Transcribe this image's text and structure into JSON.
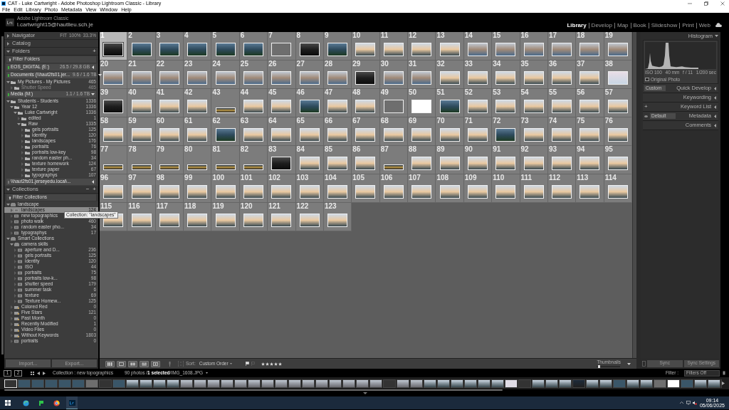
{
  "window": {
    "title": "CAT - Luke Cartwright - Adobe Photoshop Lightroom Classic - Library"
  },
  "menu": [
    "File",
    "Edit",
    "Library",
    "Photo",
    "Metadata",
    "View",
    "Window",
    "Help"
  ],
  "identity": {
    "product": "Adobe Lightroom Classic",
    "user": "l.cartwright15@hautlieu.sch.je"
  },
  "modules": [
    {
      "label": "Library",
      "selected": true
    },
    {
      "label": "Develop",
      "selected": false
    },
    {
      "label": "Map",
      "selected": false
    },
    {
      "label": "Book",
      "selected": false
    },
    {
      "label": "Slideshow",
      "selected": false
    },
    {
      "label": "Print",
      "selected": false
    },
    {
      "label": "Web",
      "selected": false
    }
  ],
  "navigator": {
    "title": "Navigator",
    "zoom_options": [
      "FIT",
      "100%",
      "33.3%"
    ]
  },
  "catalog": {
    "title": "Catalog"
  },
  "folders": {
    "title": "Folders",
    "add_button": "+",
    "filter": "Filter Folders",
    "volumes": [
      {
        "name": "EOS_DIGITAL (E:)",
        "space": "26.5 / 29.8 GB",
        "online": true,
        "expanded": false
      },
      {
        "name": "Documents (\\\\haut2fs01.jer...",
        "space": "9.6 / 1.6 TB",
        "online": true,
        "expanded": true,
        "children": [
          {
            "label": "My Pictures - My Pictures",
            "count": "465",
            "expanded": true,
            "selected": false,
            "children": [
              {
                "label": "Shutter Speed",
                "count": "465",
                "expanded": false,
                "selected": false,
                "disabled": true
              }
            ]
          }
        ]
      },
      {
        "name": "Media (M:)",
        "space": "1.1 / 1.6 TB",
        "online": true,
        "expanded": true,
        "children": [
          {
            "label": "Students - Students",
            "count": "1336",
            "expanded": true,
            "selected": false,
            "children": [
              {
                "label": "Year 12",
                "count": "1336",
                "expanded": true,
                "selected": false,
                "children": [
                  {
                    "label": "Luke Cartwright",
                    "count": "1336",
                    "expanded": true,
                    "selected": false,
                    "children": [
                      {
                        "label": "edited",
                        "count": "1",
                        "expanded": false,
                        "selected": false
                      },
                      {
                        "label": "Raw",
                        "count": "1335",
                        "expanded": true,
                        "selected": false,
                        "children": [
                          {
                            "label": "gels portraits",
                            "count": "125",
                            "expanded": false,
                            "selected": false
                          },
                          {
                            "label": "identity",
                            "count": "120",
                            "expanded": false,
                            "selected": false
                          },
                          {
                            "label": "landscapes",
                            "count": "176",
                            "expanded": false,
                            "selected": false
                          },
                          {
                            "label": "portraits",
                            "count": "76",
                            "expanded": false,
                            "selected": false
                          },
                          {
                            "label": "portraits low-key",
                            "count": "98",
                            "expanded": false,
                            "selected": false
                          },
                          {
                            "label": "random easter ph...",
                            "count": "34",
                            "expanded": false,
                            "selected": false
                          },
                          {
                            "label": "texture homework",
                            "count": "124",
                            "expanded": false,
                            "selected": false
                          },
                          {
                            "label": "texture paper",
                            "count": "67",
                            "expanded": false,
                            "selected": false
                          },
                          {
                            "label": "typographys",
                            "count": "107",
                            "expanded": false,
                            "selected": false
                          }
                        ]
                      }
                    ]
                  }
                ]
              }
            ]
          }
        ]
      },
      {
        "name": "\\\\haut2fs01.jerseyedu.local\\...",
        "online": false,
        "expanded": false
      }
    ]
  },
  "collections": {
    "title": "Collections",
    "buttons": [
      "−",
      "+"
    ],
    "filter": "Filter Collections",
    "tooltip": "Collection: \"landscapes\"",
    "tree": [
      {
        "label": "landscape",
        "kind": "set",
        "expanded": true,
        "selected": false,
        "children": [
          {
            "label": "landscapes",
            "count": "124",
            "kind": "collection",
            "expanded": false,
            "selected": true
          },
          {
            "label": "new topographics",
            "kind": "collection",
            "expanded": false,
            "selected": false
          },
          {
            "label": "photo walk",
            "count": "460",
            "kind": "collection",
            "expanded": false,
            "selected": false
          },
          {
            "label": "random easter pho...",
            "count": "34",
            "kind": "collection",
            "expanded": false,
            "selected": false
          },
          {
            "label": "typographys",
            "count": "17",
            "kind": "collection",
            "expanded": false,
            "selected": false
          }
        ]
      },
      {
        "label": "Smart Collections",
        "kind": "set",
        "expanded": true,
        "selected": false,
        "children": [
          {
            "label": "camera skills",
            "kind": "set",
            "expanded": true,
            "selected": false,
            "children": [
              {
                "label": "aperture and D...",
                "count": "236",
                "kind": "collection",
                "expanded": false,
                "selected": false
              },
              {
                "label": "gels portraits",
                "count": "125",
                "kind": "collection",
                "expanded": false,
                "selected": false
              },
              {
                "label": "identity",
                "count": "120",
                "kind": "collection",
                "expanded": false,
                "selected": false
              },
              {
                "label": "ISO",
                "count": "44",
                "kind": "collection",
                "expanded": false,
                "selected": false
              },
              {
                "label": "portraits",
                "count": "75",
                "kind": "collection",
                "expanded": false,
                "selected": false
              },
              {
                "label": "portraits low-k...",
                "count": "98",
                "kind": "collection",
                "expanded": false,
                "selected": false
              },
              {
                "label": "shutter speed",
                "count": "179",
                "kind": "collection",
                "expanded": false,
                "selected": false
              },
              {
                "label": "summer task",
                "count": "6",
                "kind": "collection",
                "expanded": false,
                "selected": false
              },
              {
                "label": "texture",
                "count": "69",
                "kind": "collection",
                "expanded": false,
                "selected": false
              },
              {
                "label": "Texture Homew...",
                "count": "125",
                "kind": "collection",
                "expanded": false,
                "selected": false
              }
            ]
          },
          {
            "label": "Colored Red",
            "count": "0",
            "kind": "smart",
            "expanded": false,
            "selected": false
          },
          {
            "label": "Five Stars",
            "count": "121",
            "kind": "smart",
            "expanded": false,
            "selected": false
          },
          {
            "label": "Past Month",
            "count": "0",
            "kind": "smart",
            "expanded": false,
            "selected": false
          },
          {
            "label": "Recently Modified",
            "count": "1",
            "kind": "smart",
            "expanded": false,
            "selected": false
          },
          {
            "label": "Video Files",
            "count": "0",
            "kind": "smart",
            "expanded": false,
            "selected": false
          },
          {
            "label": "Without Keywords",
            "count": "1803",
            "kind": "smart",
            "expanded": false,
            "selected": false
          },
          {
            "label": "portraits",
            "count": "0",
            "kind": "collection",
            "expanded": false,
            "selected": false
          }
        ]
      }
    ]
  },
  "left_buttons": [
    "Import...",
    "Export..."
  ],
  "photos": [
    {
      "number": "1",
      "kind": "dark",
      "selected": true
    },
    {
      "number": "2",
      "kind": "night",
      "selected": false
    },
    {
      "number": "3",
      "kind": "night",
      "selected": false
    },
    {
      "number": "4",
      "kind": "night",
      "selected": false
    },
    {
      "number": "5",
      "kind": "night",
      "selected": false
    },
    {
      "number": "6",
      "kind": "night",
      "selected": false
    },
    {
      "number": "7",
      "kind": "grey",
      "selected": false
    },
    {
      "number": "8",
      "kind": "dark",
      "selected": false
    },
    {
      "number": "9",
      "kind": "night",
      "selected": false
    },
    {
      "number": "10",
      "kind": "sea",
      "selected": false
    },
    {
      "number": "11",
      "kind": "sea",
      "selected": false
    },
    {
      "number": "12",
      "kind": "sea",
      "selected": false
    },
    {
      "number": "13",
      "kind": "sea",
      "selected": false
    },
    {
      "number": "14",
      "kind": "town",
      "selected": false
    },
    {
      "number": "15",
      "kind": "town",
      "selected": false
    },
    {
      "number": "16",
      "kind": "town",
      "selected": false
    },
    {
      "number": "17",
      "kind": "town",
      "selected": false
    },
    {
      "number": "18",
      "kind": "town",
      "selected": false
    },
    {
      "number": "19",
      "kind": "town",
      "selected": false
    },
    {
      "number": "20",
      "kind": "town",
      "selected": false
    },
    {
      "number": "21",
      "kind": "town",
      "selected": false
    },
    {
      "number": "22",
      "kind": "town",
      "selected": false
    },
    {
      "number": "23",
      "kind": "town",
      "selected": false
    },
    {
      "number": "24",
      "kind": "town",
      "selected": false
    },
    {
      "number": "25",
      "kind": "town",
      "selected": false
    },
    {
      "number": "26",
      "kind": "town",
      "selected": false
    },
    {
      "number": "27",
      "kind": "town",
      "selected": false
    },
    {
      "number": "28",
      "kind": "town",
      "selected": false
    },
    {
      "number": "29",
      "kind": "dark",
      "selected": false
    },
    {
      "number": "30",
      "kind": "town",
      "selected": false
    },
    {
      "number": "31",
      "kind": "town",
      "selected": false
    },
    {
      "number": "32",
      "kind": "sea",
      "selected": false
    },
    {
      "number": "33",
      "kind": "sea",
      "selected": false
    },
    {
      "number": "34",
      "kind": "sea",
      "selected": false
    },
    {
      "number": "35",
      "kind": "sea",
      "selected": false
    },
    {
      "number": "36",
      "kind": "sea",
      "selected": false
    },
    {
      "number": "37",
      "kind": "sea",
      "selected": false
    },
    {
      "number": "38",
      "kind": "pale",
      "selected": false
    },
    {
      "number": "39",
      "kind": "dark",
      "selected": false
    },
    {
      "number": "40",
      "kind": "sea",
      "selected": false
    },
    {
      "number": "41",
      "kind": "sea",
      "selected": false
    },
    {
      "number": "42",
      "kind": "sea",
      "selected": false
    },
    {
      "number": "43",
      "kind": "wide",
      "selected": false
    },
    {
      "number": "44",
      "kind": "sea",
      "selected": false
    },
    {
      "number": "45",
      "kind": "sea",
      "selected": false
    },
    {
      "number": "46",
      "kind": "night",
      "selected": false
    },
    {
      "number": "47",
      "kind": "sea",
      "selected": false
    },
    {
      "number": "48",
      "kind": "sea",
      "selected": false
    },
    {
      "number": "49",
      "kind": "grey",
      "selected": false
    },
    {
      "number": "50",
      "kind": "white",
      "selected": false
    },
    {
      "number": "51",
      "kind": "night",
      "selected": false
    },
    {
      "number": "52",
      "kind": "sea",
      "selected": false
    },
    {
      "number": "53",
      "kind": "sea",
      "selected": false
    },
    {
      "number": "54",
      "kind": "sea",
      "selected": false
    },
    {
      "number": "55",
      "kind": "sea",
      "selected": false
    },
    {
      "number": "56",
      "kind": "sea",
      "selected": false
    },
    {
      "number": "57",
      "kind": "sea",
      "selected": false
    },
    {
      "number": "58",
      "kind": "sea",
      "selected": false
    },
    {
      "number": "59",
      "kind": "sea",
      "selected": false
    },
    {
      "number": "60",
      "kind": "sea",
      "selected": false
    },
    {
      "number": "61",
      "kind": "sea",
      "selected": false
    },
    {
      "number": "62",
      "kind": "night",
      "selected": false
    },
    {
      "number": "63",
      "kind": "sea",
      "selected": false
    },
    {
      "number": "64",
      "kind": "sea",
      "selected": false
    },
    {
      "number": "65",
      "kind": "sea",
      "selected": false
    },
    {
      "number": "66",
      "kind": "sea",
      "selected": false
    },
    {
      "number": "67",
      "kind": "sea",
      "selected": false
    },
    {
      "number": "68",
      "kind": "sea",
      "selected": false
    },
    {
      "number": "69",
      "kind": "sea",
      "selected": false
    },
    {
      "number": "70",
      "kind": "sea",
      "selected": false
    },
    {
      "number": "71",
      "kind": "sea",
      "selected": false
    },
    {
      "number": "72",
      "kind": "night",
      "selected": false
    },
    {
      "number": "73",
      "kind": "sea",
      "selected": false
    },
    {
      "number": "74",
      "kind": "sea",
      "selected": false
    },
    {
      "number": "75",
      "kind": "sea",
      "selected": false
    },
    {
      "number": "76",
      "kind": "sea",
      "selected": false
    },
    {
      "number": "77",
      "kind": "wide",
      "selected": false
    },
    {
      "number": "78",
      "kind": "wide",
      "selected": false
    },
    {
      "number": "79",
      "kind": "wide",
      "selected": false
    },
    {
      "number": "80",
      "kind": "wide",
      "selected": false
    },
    {
      "number": "81",
      "kind": "wide",
      "selected": false
    },
    {
      "number": "82",
      "kind": "wide",
      "selected": false
    },
    {
      "number": "83",
      "kind": "dark",
      "selected": false
    },
    {
      "number": "84",
      "kind": "sea",
      "selected": false
    },
    {
      "number": "85",
      "kind": "sea",
      "selected": false
    },
    {
      "number": "86",
      "kind": "sea",
      "selected": false
    },
    {
      "number": "87",
      "kind": "wide",
      "selected": false
    },
    {
      "number": "88",
      "kind": "sea",
      "selected": false
    },
    {
      "number": "89",
      "kind": "sea",
      "selected": false
    },
    {
      "number": "90",
      "kind": "sea",
      "selected": false
    },
    {
      "number": "91",
      "kind": "sea",
      "selected": false
    },
    {
      "number": "92",
      "kind": "sea",
      "selected": false
    },
    {
      "number": "93",
      "kind": "sea",
      "selected": false
    },
    {
      "number": "94",
      "kind": "sea",
      "selected": false
    },
    {
      "number": "95",
      "kind": "sea",
      "selected": false
    },
    {
      "number": "96",
      "kind": "sea",
      "selected": false
    },
    {
      "number": "97",
      "kind": "sea",
      "selected": false
    },
    {
      "number": "98",
      "kind": "sea",
      "selected": false
    },
    {
      "number": "99",
      "kind": "sea",
      "selected": false
    },
    {
      "number": "100",
      "kind": "sea",
      "selected": false
    },
    {
      "number": "101",
      "kind": "sea",
      "selected": false
    },
    {
      "number": "102",
      "kind": "sea",
      "selected": false
    },
    {
      "number": "103",
      "kind": "sea",
      "selected": false
    },
    {
      "number": "104",
      "kind": "sea",
      "selected": false
    },
    {
      "number": "105",
      "kind": "sea",
      "selected": false
    },
    {
      "number": "106",
      "kind": "sea",
      "selected": false
    },
    {
      "number": "107",
      "kind": "sea",
      "selected": false
    },
    {
      "number": "108",
      "kind": "sea",
      "selected": false
    },
    {
      "number": "109",
      "kind": "sea",
      "selected": false
    },
    {
      "number": "110",
      "kind": "sea",
      "selected": false
    },
    {
      "number": "111",
      "kind": "sea",
      "selected": false
    },
    {
      "number": "112",
      "kind": "sea",
      "selected": false
    },
    {
      "number": "113",
      "kind": "sea",
      "selected": false
    },
    {
      "number": "114",
      "kind": "sea",
      "selected": false
    },
    {
      "number": "115",
      "kind": "sea",
      "selected": false
    },
    {
      "number": "116",
      "kind": "sea",
      "selected": false
    },
    {
      "number": "117",
      "kind": "sea",
      "selected": false
    },
    {
      "number": "118",
      "kind": "sea",
      "selected": false
    },
    {
      "number": "119",
      "kind": "sea",
      "selected": false
    },
    {
      "number": "120",
      "kind": "sea",
      "selected": false
    },
    {
      "number": "121",
      "kind": "sea",
      "selected": false
    },
    {
      "number": "122",
      "kind": "sea",
      "selected": false
    },
    {
      "number": "123",
      "kind": "sea",
      "selected": false
    }
  ],
  "toolbar": {
    "sort_label": "Sort:",
    "sort_value": "Custom Order",
    "thumbnails": {
      "label": "Thumbnails",
      "level": 0.05
    }
  },
  "right_panel": {
    "histogram": {
      "title": "Histogram",
      "readouts": [
        "ISO 100",
        "40 mm",
        "f / 11",
        "1/200 sec"
      ],
      "original_photo": {
        "label": "Original Photo",
        "checked": false
      }
    },
    "sections": [
      {
        "title": "Quick Develop",
        "control": "Custom"
      },
      {
        "title": "Keywording"
      },
      {
        "title": "Keyword List",
        "button": "+"
      },
      {
        "title": "Metadata",
        "control": "Default"
      },
      {
        "title": "Comments"
      }
    ],
    "buttons": [
      "Sync",
      "Sync Settings"
    ]
  },
  "filmstrip": {
    "monitors": [
      "1",
      "2"
    ],
    "source": "Collection : new topographics",
    "count": "90 photos /",
    "selected": "1 selected",
    "file": "/IMG_1608.JPG",
    "filter_label": "Filter :",
    "filter_value": "Filters Off"
  },
  "taskbar": {
    "time": "09:14",
    "date": "05/06/2025"
  }
}
